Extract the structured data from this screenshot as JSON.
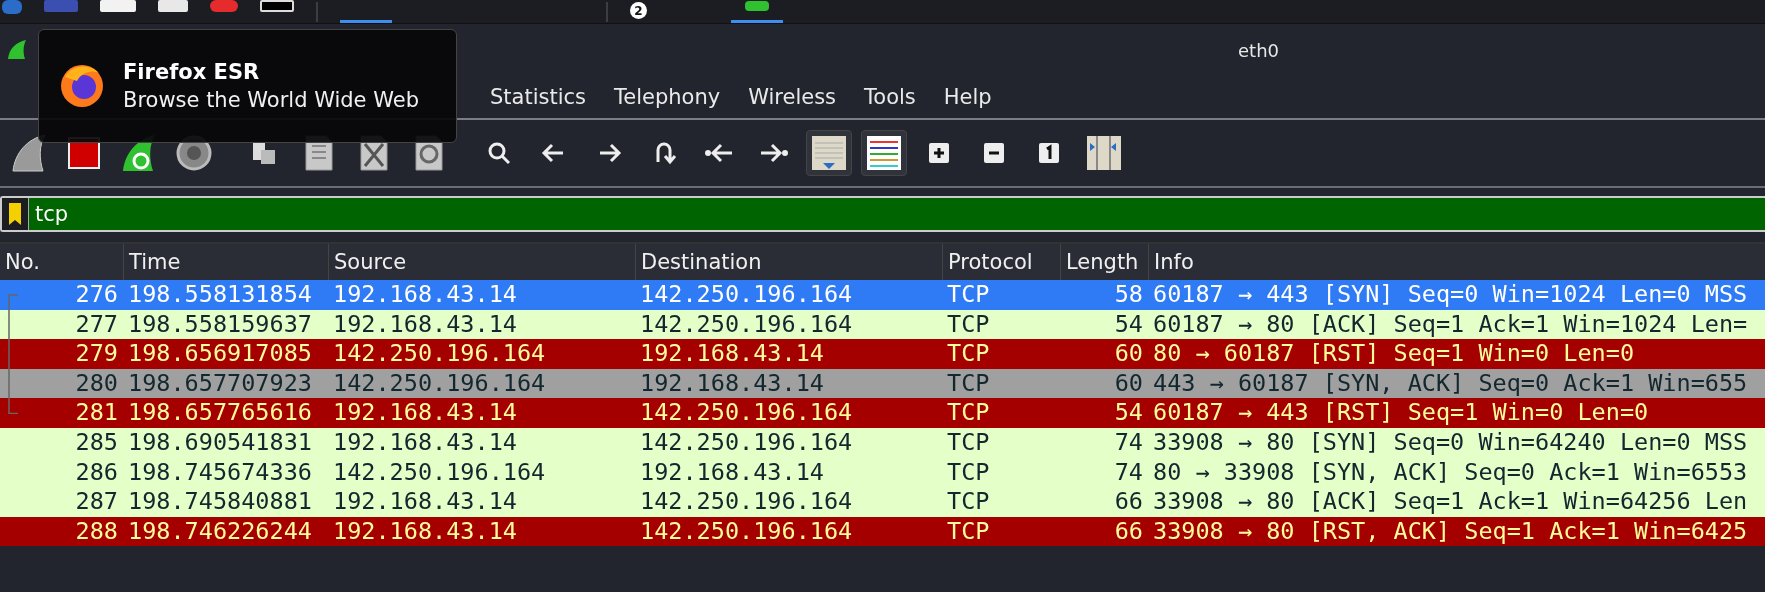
{
  "taskbar": {
    "badge": "2"
  },
  "tooltip": {
    "title": "Firefox ESR",
    "subtitle": "Browse the World Wide Web"
  },
  "window": {
    "title": "eth0"
  },
  "menu": [
    {
      "label": "Statistics"
    },
    {
      "label": "Telephony"
    },
    {
      "label": "Wireless"
    },
    {
      "label": "Tools"
    },
    {
      "label": "Help"
    }
  ],
  "filter": {
    "value": "tcp"
  },
  "table": {
    "columns": [
      "No.",
      "Time",
      "Source",
      "Destination",
      "Protocol",
      "Length",
      "Info"
    ],
    "rows": [
      {
        "selected": true,
        "cells": [
          "276",
          "198.558131854",
          "192.168.43.14",
          "142.250.196.164",
          "TCP",
          "58",
          "60187 → 443 [SYN] Seq=0 Win=1024 Len=0 MSS"
        ]
      },
      {
        "selected": false,
        "color": "#e4ffc7",
        "cells": [
          "277",
          "198.558159637",
          "192.168.43.14",
          "142.250.196.164",
          "TCP",
          "54",
          "60187 → 80 [ACK] Seq=1 Ack=1 Win=1024 Len="
        ]
      },
      {
        "selected": false,
        "color": "#a40000",
        "cells": [
          "279",
          "198.656917085",
          "142.250.196.164",
          "192.168.43.14",
          "TCP",
          "60",
          "80 → 60187 [RST] Seq=1 Win=0 Len=0"
        ]
      },
      {
        "selected": false,
        "color": "#a0a0a0",
        "cells": [
          "280",
          "198.657707923",
          "142.250.196.164",
          "192.168.43.14",
          "TCP",
          "60",
          "443 → 60187 [SYN, ACK] Seq=0 Ack=1 Win=655"
        ]
      },
      {
        "selected": false,
        "color": "#a40000",
        "cells": [
          "281",
          "198.657765616",
          "192.168.43.14",
          "142.250.196.164",
          "TCP",
          "54",
          "60187 → 443 [RST] Seq=1 Win=0 Len=0"
        ]
      },
      {
        "selected": false,
        "color": "#e4ffc7",
        "cells": [
          "285",
          "198.690541831",
          "192.168.43.14",
          "142.250.196.164",
          "TCP",
          "74",
          "33908 → 80 [SYN] Seq=0 Win=64240 Len=0 MSS"
        ]
      },
      {
        "selected": false,
        "color": "#e4ffc7",
        "cells": [
          "286",
          "198.745674336",
          "142.250.196.164",
          "192.168.43.14",
          "TCP",
          "74",
          "80 → 33908 [SYN, ACK] Seq=0 Ack=1 Win=6553"
        ]
      },
      {
        "selected": false,
        "color": "#e4ffc7",
        "cells": [
          "287",
          "198.745840881",
          "192.168.43.14",
          "142.250.196.164",
          "TCP",
          "66",
          "33908 → 80 [ACK] Seq=1 Ack=1 Win=64256 Len"
        ]
      },
      {
        "selected": false,
        "color": "#a40000",
        "cells": [
          "288",
          "198.746226244",
          "192.168.43.14",
          "142.250.196.164",
          "TCP",
          "66",
          "33908 → 80 [RST, ACK] Seq=1 Ack=1 Win=6425"
        ]
      }
    ]
  }
}
